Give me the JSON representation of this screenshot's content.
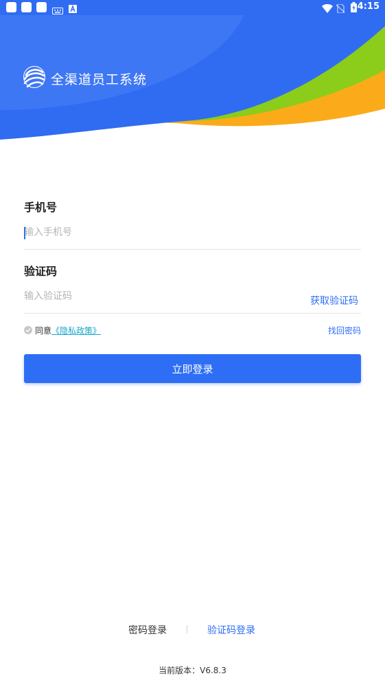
{
  "status_bar": {
    "time": "4:15"
  },
  "header": {
    "brand_title": "全渠道员工系统"
  },
  "form": {
    "phone": {
      "label": "手机号",
      "placeholder": "输入手机号",
      "value": ""
    },
    "code": {
      "label": "验证码",
      "placeholder": "输入验证码",
      "value": "",
      "get_code_label": "获取验证码"
    }
  },
  "agreement": {
    "agree_text": "同意",
    "privacy_link": "《隐私政策》",
    "forgot_label": "找回密码"
  },
  "login_button": {
    "label": "立即登录"
  },
  "bottom_tabs": {
    "password_login": "密码登录",
    "code_login": "验证码登录"
  },
  "version": {
    "label": "当前版本：V6.8.3"
  },
  "colors": {
    "primary": "#2e6ef5",
    "header_blue": "#2f6cf2",
    "green": "#8ccc1a",
    "orange": "#fbab1a"
  }
}
